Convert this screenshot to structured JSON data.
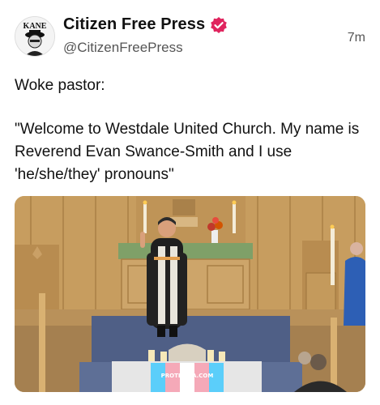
{
  "account": {
    "display_name": "Citizen Free Press",
    "handle": "@CitizenFreePress",
    "avatar_text": "KANE",
    "verified_color": "#e0245e"
  },
  "post": {
    "time": "7m",
    "line1": "Woke pastor:",
    "quote": "\"Welcome to Westdale United Church. My name is Reverend Evan Swance-Smith and I use 'he/she/they' pronouns\""
  },
  "media": {
    "banner_text": "PROTESTIA.COM",
    "flag_colors": [
      "#5bcefa",
      "#f5a9b8",
      "#ffffff",
      "#f5a9b8",
      "#5bcefa"
    ]
  }
}
